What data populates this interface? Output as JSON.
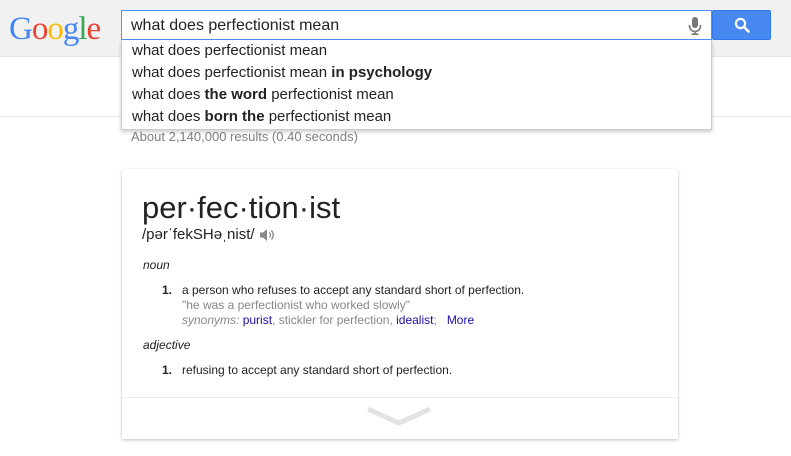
{
  "header": {
    "logo_letters": [
      {
        "char": "G",
        "color": "#4285f4"
      },
      {
        "char": "o",
        "color": "#ea4335"
      },
      {
        "char": "o",
        "color": "#fbbc05"
      },
      {
        "char": "g",
        "color": "#4285f4"
      },
      {
        "char": "l",
        "color": "#34a853"
      },
      {
        "char": "e",
        "color": "#ea4335"
      }
    ],
    "search_value": "what does perfectionist mean",
    "mic_icon": "microphone-icon",
    "search_button_icon": "magnifier-icon"
  },
  "suggestions": [
    {
      "plain_before": "what does perfectionist mean",
      "bold": "",
      "plain_after": ""
    },
    {
      "plain_before": "what does perfectionist mean ",
      "bold": "in psychology",
      "plain_after": ""
    },
    {
      "plain_before": "what does ",
      "bold": "the word",
      "plain_after": " perfectionist mean"
    },
    {
      "plain_before": "what does ",
      "bold": "born the",
      "plain_after": " perfectionist mean"
    }
  ],
  "results_stats": "About 2,140,000 results (0.40 seconds)",
  "definition": {
    "word": "per·fec·tion·ist",
    "phonetic": "/pərˈfekSHəˌnist/",
    "senses": [
      {
        "pos": "noun",
        "number": "1.",
        "text": "a person who refuses to accept any standard short of perfection.",
        "example": "\"he was a perfectionist who worked slowly\"",
        "synonyms_label": "synonyms:",
        "synonyms": [
          "purist",
          "stickler for perfection",
          "idealist"
        ],
        "more_label": "More"
      },
      {
        "pos": "adjective",
        "number": "1.",
        "text": "refusing to accept any standard short of perfection."
      }
    ]
  },
  "colors": {
    "accent_blue": "#4889f1",
    "link": "#1a0dab",
    "muted": "#878787"
  }
}
